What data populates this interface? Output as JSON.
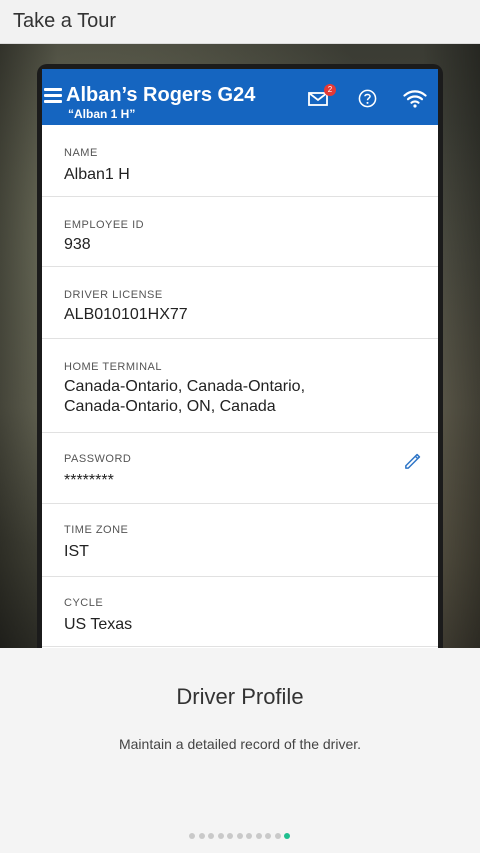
{
  "header": {
    "title": "Take a Tour"
  },
  "device": {
    "app_title": "Alban’s Rogers G24",
    "app_subtitle": "“Alban 1 H”",
    "mail_badge": "2",
    "icons": [
      "menu-icon",
      "mail-icon",
      "help-icon",
      "wifi-icon",
      "pencil-icon"
    ],
    "accent_color": "#1565c0",
    "badge_color": "#e53935"
  },
  "profile": {
    "name": {
      "label": "NAME",
      "value": "Alban1 H"
    },
    "employee_id": {
      "label": "EMPLOYEE ID",
      "value": "938"
    },
    "driver_license": {
      "label": "DRIVER LICENSE",
      "value": "ALB010101HX77"
    },
    "home_terminal": {
      "label": "HOME TERMINAL",
      "value": "Canada-Ontario, Canada-Ontario, Canada-Ontario, ON, Canada"
    },
    "password": {
      "label": "PASSWORD",
      "value": "********"
    },
    "time_zone": {
      "label": "TIME ZONE",
      "value": "IST"
    },
    "cycle": {
      "label": "CYCLE",
      "value": "US Texas"
    }
  },
  "slide": {
    "title": "Driver Profile",
    "description": "Maintain a detailed record of the driver.",
    "page_count": 11,
    "current_page": 11,
    "active_dot_color": "#1fbf8f"
  }
}
